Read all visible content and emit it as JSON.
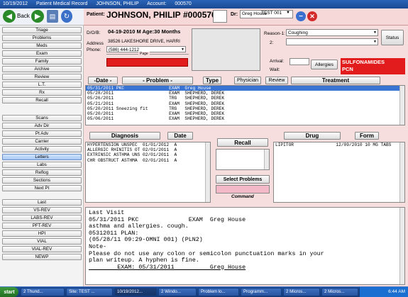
{
  "titlebar": {
    "date": "10/19/2012",
    "app": "Patient Medical Record",
    "patient": "JOHNSON, PHILIP",
    "account_label": "Account:",
    "account": "000570"
  },
  "nav": {
    "back_label": "Back"
  },
  "header": {
    "patient_label": "Patient:",
    "patient_name": "JOHNSON, PHILIP",
    "account_no": "#000570",
    "dr_label": "Dr:",
    "dr_value": "Greg House",
    "dr_location": "TEST 001"
  },
  "sidebar": {
    "group1": [
      "Triage",
      "Problems",
      "Meds",
      "Exam",
      "Family",
      "Archive",
      "Review",
      "L.T.",
      "Rx",
      "Recall"
    ],
    "group2": [
      "Scans",
      "Adv Dir",
      "Pt Adv",
      "Carrier",
      "Activity",
      "Letters",
      "Labs",
      "Reflog",
      "Sections",
      "Next Pt"
    ],
    "group3": [
      "Last",
      "VS-REV",
      "LABS-REV",
      "PFT-REV",
      "HPI",
      "VIAL",
      "VIAL-REV",
      "NEWP"
    ],
    "active": "Letters"
  },
  "demo": {
    "dob_label": "D/O/B:",
    "dob": "04-19-2010 M Age:30 Months",
    "address_label": "Address",
    "address": "38526 LAKESHORE DRIVE, HARRI",
    "phone_label": "Phone:",
    "phone": "(586) 444-1212",
    "pager_label": "Page"
  },
  "visit": {
    "reason1_label": "Reason-1:",
    "reason1": "Coughing",
    "reason2_label": "2:",
    "reason2": "",
    "status_label": "Status",
    "arrival_label": "Arrival:",
    "wait_label": "Wait:",
    "allergies_label": "Allergies",
    "allergies": [
      "SULFONAMIDES",
      "PCN"
    ]
  },
  "encounter_toolbar": {
    "date": "-Date -",
    "problem": "- Problem -",
    "type": "Type",
    "physician": "Physician",
    "review": "Review",
    "treatment": "Treatment"
  },
  "encounters": [
    "05/31/2011 PKC                 EXAM  Greg House",
    "05/28/2011                     EXAM  SHEPHERD, DEREK",
    "05/26/2011                     TRG   SHEPHERD, DEREK",
    "05/21/2011                     EXAM  SHEPHERD, DEREK",
    "05/20/2011 Sneezing fit        TRG   SHEPHERD, DEREK",
    "05/20/2011                     EXAM  SHEPHERD, DEREK",
    "05/06/2011                     EXAM  SHEPHERD, DEREK"
  ],
  "diagnosis": {
    "header": "Diagnosis",
    "date_header": "Date",
    "rows": [
      "HYPERTENSION UNSPEC  01/01/2012  A",
      "ALLERGIC RHINITIS OT 02/01/2011  A",
      "EXTRINSIC ASTHMA UNS 02/01/2011  A",
      "CHR OBSTRUCT ASTHMA  02/01/2011  A"
    ]
  },
  "recall": {
    "header": "Recall",
    "select_problems": "Select Problems",
    "command_label": "Command"
  },
  "drugs": {
    "header": "Drug",
    "form_header": "Form",
    "rows": [
      "LIPITOR                12/09/2010 10 MG TABS"
    ]
  },
  "note": {
    "lines": [
      "Last Visit",
      "05/31/2011 PKC              EXAM  Greg House",
      "asthma and allergies. cough.",
      "05312011 PLAN:",
      "(05/28/11 09:29-OMNI 001) (PLN2)",
      "Note-",
      "Please do not use any colon or semicolon punctuation marks in your",
      "plan writeup. A hyphen is fine.",
      "        EXAM: 05/31/2011          Greg House"
    ]
  },
  "taskbar": {
    "start": "start",
    "tasks": [
      "2 Thund...",
      "Site: TEST ...",
      "10/19/2012...",
      "2 Windo...",
      "Problem lo...",
      "Programm...",
      "2 Micros...",
      "2 Micros..."
    ],
    "active_index": 2,
    "clock": "6:44 AM"
  }
}
